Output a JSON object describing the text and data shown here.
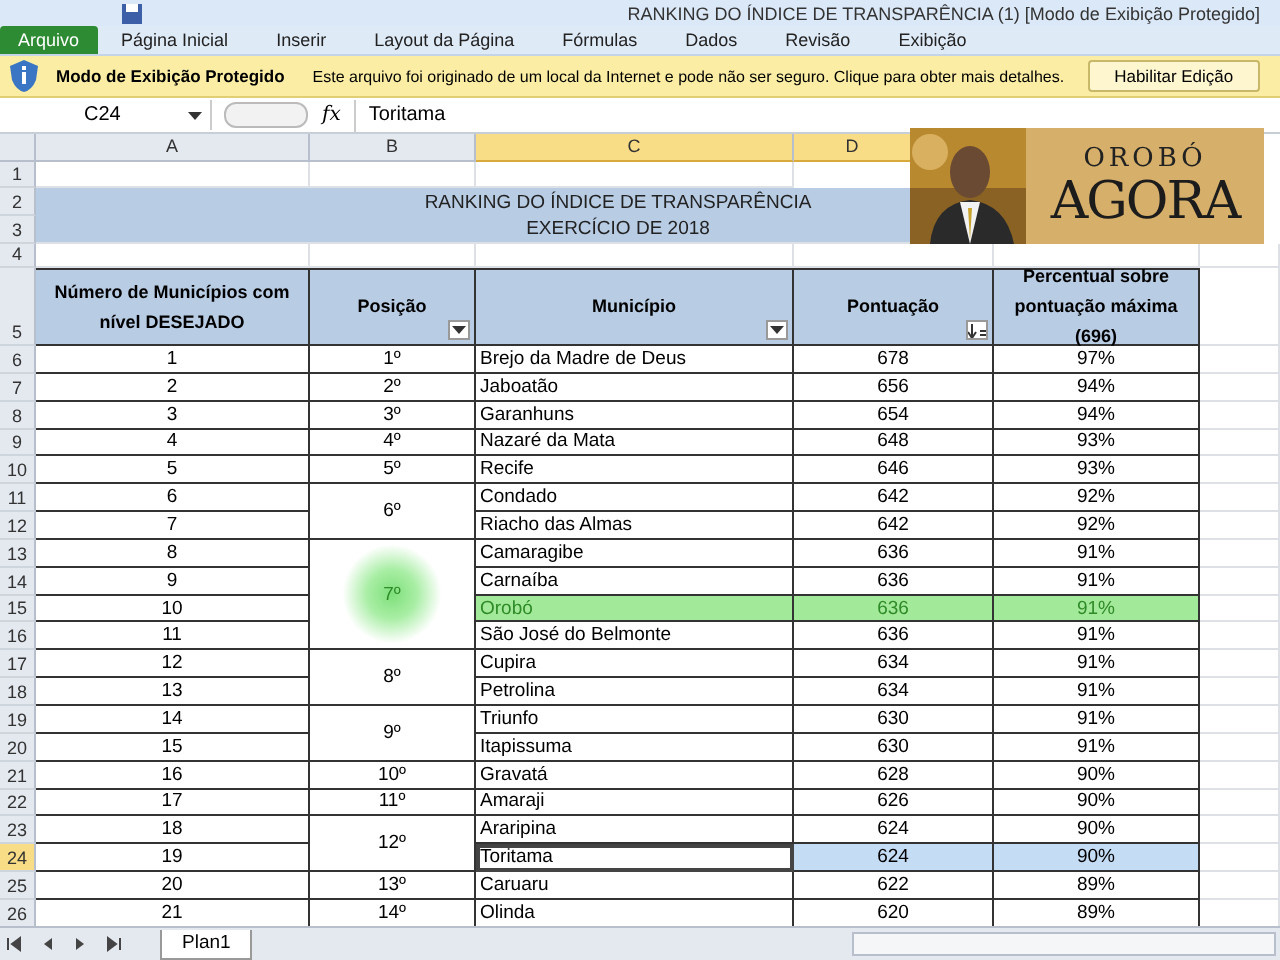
{
  "window": {
    "title": "RANKING DO ÍNDICE DE TRANSPARÊNCIA (1)  [Modo de Exibição Protegido]"
  },
  "ribbon_tabs": [
    {
      "label": "Arquivo",
      "kind": "file"
    },
    {
      "label": "Página Inicial",
      "kind": "tab"
    },
    {
      "label": "Inserir",
      "kind": "tab"
    },
    {
      "label": "Layout da Página",
      "kind": "tab"
    },
    {
      "label": "Fórmulas",
      "kind": "tab"
    },
    {
      "label": "Dados",
      "kind": "tab"
    },
    {
      "label": "Revisão",
      "kind": "tab"
    },
    {
      "label": "Exibição",
      "kind": "tab"
    }
  ],
  "protected_bar": {
    "title": "Modo de Exibição Protegido",
    "message": "Este arquivo foi originado de um local da Internet e pode não ser seguro. Clique para obter mais detalhes.",
    "button": "Habilitar Edição"
  },
  "formula_bar": {
    "name_box": "C24",
    "fx": "fx",
    "value": "Toritama"
  },
  "columns": [
    {
      "label": "A",
      "selected": false
    },
    {
      "label": "B",
      "selected": false
    },
    {
      "label": "C",
      "selected": true
    },
    {
      "label": "D",
      "selected": true
    }
  ],
  "logo": {
    "line_1": "OROBÓ",
    "line_2": "AGORA"
  },
  "title": {
    "line_1": "RANKING DO ÍNDICE DE TRANSPARÊNCIA",
    "line_2": "EXERCÍCIO DE 2018"
  },
  "row_numbers": [
    "1",
    "2",
    "3",
    "4",
    "5"
  ],
  "table": {
    "headers": [
      {
        "label": "Número de Municípios com nível DESEJADO",
        "kind": "plain"
      },
      {
        "label": "Posição",
        "kind": "dropdown"
      },
      {
        "label": "Município",
        "kind": "dropdown"
      },
      {
        "label": "Pontuação",
        "kind": "sorted"
      },
      {
        "label": "Percentual sobre pontuação máxima (696)",
        "kind": "plain"
      }
    ],
    "groups": [
      {
        "position": "1º",
        "highlighted": false,
        "entries": [
          {
            "row": "6",
            "number": "1",
            "municipio": "Brejo da Madre de Deus",
            "pontuacao": "678",
            "percentual": "97%",
            "highlighted": false,
            "selected": false
          }
        ]
      },
      {
        "position": "2º",
        "highlighted": false,
        "entries": [
          {
            "row": "7",
            "number": "2",
            "municipio": "Jaboatão",
            "pontuacao": "656",
            "percentual": "94%",
            "highlighted": false,
            "selected": false
          }
        ]
      },
      {
        "position": "3º",
        "highlighted": false,
        "entries": [
          {
            "row": "8",
            "number": "3",
            "municipio": "Garanhuns",
            "pontuacao": "654",
            "percentual": "94%",
            "highlighted": false,
            "selected": false
          }
        ]
      },
      {
        "position": "4º",
        "highlighted": false,
        "entries": [
          {
            "row": "9",
            "number": "4",
            "municipio": "Nazaré da Mata",
            "pontuacao": "648",
            "percentual": "93%",
            "highlighted": false,
            "selected": false
          }
        ]
      },
      {
        "position": "5º",
        "highlighted": false,
        "entries": [
          {
            "row": "10",
            "number": "5",
            "municipio": "Recife",
            "pontuacao": "646",
            "percentual": "93%",
            "highlighted": false,
            "selected": false
          }
        ]
      },
      {
        "position": "6º",
        "highlighted": false,
        "entries": [
          {
            "row": "11",
            "number": "6",
            "municipio": "Condado",
            "pontuacao": "642",
            "percentual": "92%",
            "highlighted": false,
            "selected": false
          },
          {
            "row": "12",
            "number": "7",
            "municipio": "Riacho das Almas",
            "pontuacao": "642",
            "percentual": "92%",
            "highlighted": false,
            "selected": false
          }
        ]
      },
      {
        "position": "7º",
        "highlighted": true,
        "entries": [
          {
            "row": "13",
            "number": "8",
            "municipio": "Camaragibe",
            "pontuacao": "636",
            "percentual": "91%",
            "highlighted": false,
            "selected": false
          },
          {
            "row": "14",
            "number": "9",
            "municipio": "Carnaíba",
            "pontuacao": "636",
            "percentual": "91%",
            "highlighted": false,
            "selected": false
          },
          {
            "row": "15",
            "number": "10",
            "municipio": "Orobó",
            "pontuacao": "636",
            "percentual": "91%",
            "highlighted": true,
            "selected": false
          },
          {
            "row": "16",
            "number": "11",
            "municipio": "São José do Belmonte",
            "pontuacao": "636",
            "percentual": "91%",
            "highlighted": false,
            "selected": false
          }
        ]
      },
      {
        "position": "8º",
        "highlighted": false,
        "entries": [
          {
            "row": "17",
            "number": "12",
            "municipio": "Cupira",
            "pontuacao": "634",
            "percentual": "91%",
            "highlighted": false,
            "selected": false
          },
          {
            "row": "18",
            "number": "13",
            "municipio": "Petrolina",
            "pontuacao": "634",
            "percentual": "91%",
            "highlighted": false,
            "selected": false
          }
        ]
      },
      {
        "position": "9º",
        "highlighted": false,
        "entries": [
          {
            "row": "19",
            "number": "14",
            "municipio": "Triunfo",
            "pontuacao": "630",
            "percentual": "91%",
            "highlighted": false,
            "selected": false
          },
          {
            "row": "20",
            "number": "15",
            "municipio": "Itapissuma",
            "pontuacao": "630",
            "percentual": "91%",
            "highlighted": false,
            "selected": false
          }
        ]
      },
      {
        "position": "10º",
        "highlighted": false,
        "entries": [
          {
            "row": "21",
            "number": "16",
            "municipio": "Gravatá",
            "pontuacao": "628",
            "percentual": "90%",
            "highlighted": false,
            "selected": false
          }
        ]
      },
      {
        "position": "11º",
        "highlighted": false,
        "entries": [
          {
            "row": "22",
            "number": "17",
            "municipio": "Amaraji",
            "pontuacao": "626",
            "percentual": "90%",
            "highlighted": false,
            "selected": false
          }
        ]
      },
      {
        "position": "12º",
        "highlighted": false,
        "entries": [
          {
            "row": "23",
            "number": "18",
            "municipio": "Araripina",
            "pontuacao": "624",
            "percentual": "90%",
            "highlighted": false,
            "selected": false
          },
          {
            "row": "24",
            "number": "19",
            "municipio": "Toritama",
            "pontuacao": "624",
            "percentual": "90%",
            "highlighted": false,
            "selected": true
          }
        ]
      },
      {
        "position": "13º",
        "highlighted": false,
        "entries": [
          {
            "row": "25",
            "number": "20",
            "municipio": "Caruaru",
            "pontuacao": "622",
            "percentual": "89%",
            "highlighted": false,
            "selected": false
          }
        ]
      },
      {
        "position": "14º",
        "highlighted": false,
        "entries": [
          {
            "row": "26",
            "number": "21",
            "municipio": "Olinda",
            "pontuacao": "620",
            "percentual": "89%",
            "highlighted": false,
            "selected": false
          }
        ]
      }
    ]
  },
  "sheet_tabs": [
    {
      "label": "Plan1",
      "selected": true
    }
  ]
}
